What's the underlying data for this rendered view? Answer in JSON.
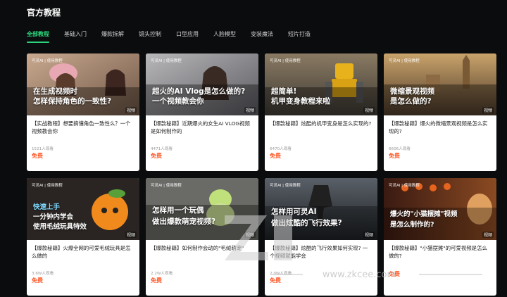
{
  "header": {
    "title": "官方教程"
  },
  "tabs": [
    {
      "label": "全部教程",
      "active": true
    },
    {
      "label": "基础入门"
    },
    {
      "label": "爆款拆解"
    },
    {
      "label": "镜头控制"
    },
    {
      "label": "口型应用"
    },
    {
      "label": "人脸模型"
    },
    {
      "label": "变装魔法"
    },
    {
      "label": "短片打造"
    }
  ],
  "cards": [
    {
      "brand": "可灵AI | 使用教程",
      "headline1": "在生成视频时",
      "headline2": "怎样保持角色的一致性?",
      "tag": "视频",
      "title": "【实战教程】想要搞懂角色一致性么？一个视频教会你",
      "views": "1521人观看",
      "price": "免费"
    },
    {
      "brand": "可灵AI | 使用教程",
      "headline1": "超火的AI Vlog是怎么做的?",
      "headline2": "一个视频教会你",
      "tag": "视频",
      "title": "【爆款秘籍】近期爆火的女生AI VLOG视频是如何制作的",
      "views": "4471人观看",
      "price": "免费"
    },
    {
      "brand": "可灵AI | 使用教程",
      "headline1": "超简单!",
      "headline2": "机甲变身教程来啦",
      "tag": "视频",
      "title": "【爆款秘籍】炫酷的机甲变身是怎么实现的?",
      "views": "6470人观看",
      "price": "免费"
    },
    {
      "brand": "可灵AI | 使用教程",
      "headline1": "微缩景观视频",
      "headline2": "是怎么做的?",
      "tag": "视频",
      "title": "【爆款秘籍】爆火的微缩景观视频是怎么实现的?",
      "views": "6606人观看",
      "price": "免费"
    },
    {
      "brand": "可灵AI | 使用教程",
      "headline1": "快速上手",
      "headline2": "一分钟内学会",
      "headline3": "使用毛绒玩具特效",
      "tag": "视频",
      "title": "【爆款秘籍】火爆全网的可爱毛绒玩具是怎么做的",
      "views": "3.6W人观看",
      "price": "免费"
    },
    {
      "brand": "可灵AI | 使用教程",
      "headline1": "怎样用一个玩偶",
      "headline2": "做出爆款萌宠视频?",
      "tag": "视频",
      "title": "【爆款秘籍】如何制作会动的\"毛绒萌宠\"",
      "views": "2.2W人观看",
      "price": "免费"
    },
    {
      "brand": "可灵AI | 使用教程",
      "headline1": "怎样用可灵AI",
      "headline2": "做出炫酷的飞行效果?",
      "tag": "视频",
      "title": "【爆款秘籍】炫酷的飞行效果如何实现? 一个视频就能学会",
      "views": "2.0W人观看",
      "price": "免费"
    },
    {
      "brand": "可灵AI | 使用教程",
      "headline1": "爆火的\"小猫摆摊\"视频",
      "headline2": "是怎么制作的?",
      "tag": "视频",
      "title": "【爆款秘籍】\"小猫摆摊\"的可爱视频是怎么做的?",
      "views": "",
      "price": "免费"
    }
  ],
  "watermark": {
    "text": "www.zkcee.com"
  },
  "colors": {
    "accent": "#2bd47a",
    "price": "#ff5a2a",
    "background": "#0b0c0e"
  }
}
